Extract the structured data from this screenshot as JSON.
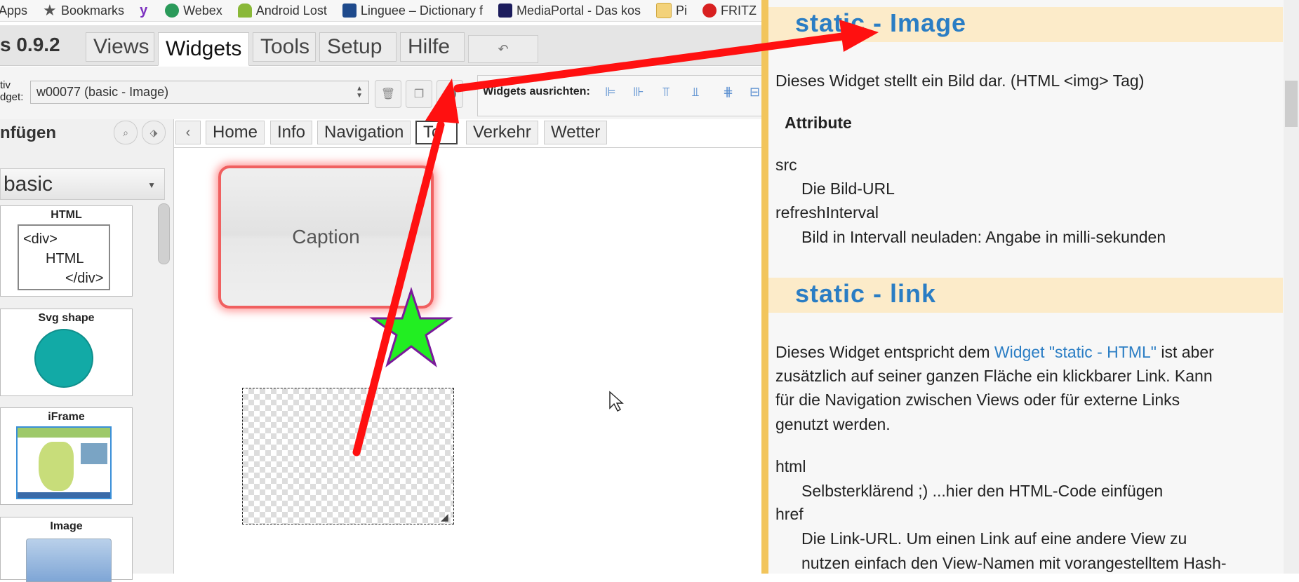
{
  "bookmarks": [
    {
      "label": "Apps",
      "icon": "apps-icon",
      "color": "#4a6ee0"
    },
    {
      "label": "Bookmarks",
      "icon": "star-icon",
      "color": "#555555"
    },
    {
      "label": "",
      "icon": "yahoo-icon",
      "color": "#7b2fbf"
    },
    {
      "label": "Webex",
      "icon": "webex-icon",
      "color": "#2a9a5a"
    },
    {
      "label": "Android Lost",
      "icon": "android-icon",
      "color": "#8ab838"
    },
    {
      "label": "Linguee – Dictionary f",
      "icon": "linguee-icon",
      "color": "#1e4a8c"
    },
    {
      "label": "MediaPortal - Das kos",
      "icon": "mediaportal-icon",
      "color": "#1c1c5c"
    },
    {
      "label": "Pi",
      "icon": "folder-icon",
      "color": "#e8c35a"
    },
    {
      "label": "FRITZ",
      "icon": "fritz-icon",
      "color": "#d82020"
    }
  ],
  "app": {
    "title": "s 0.9.2",
    "tabs": [
      "Views",
      "Widgets",
      "Tools",
      "Setup",
      "Hilfe"
    ],
    "active_tab": "Widgets",
    "undo_glyph": "↶"
  },
  "toolbar": {
    "aktiv_label_1": "tiv",
    "aktiv_label_2": "dget:",
    "selected_widget": "w00077 (basic - Image)",
    "align_label": "Widgets ausrichten:"
  },
  "palette": {
    "title": "nfügen",
    "category": "basic",
    "widgets": [
      {
        "title": "HTML",
        "preview_lines": [
          "<div>",
          "HTML",
          "</div>"
        ]
      },
      {
        "title": "Svg shape"
      },
      {
        "title": "iFrame"
      },
      {
        "title": "Image"
      }
    ]
  },
  "views": {
    "prev_glyph": "‹",
    "tabs": [
      "Home",
      "Info",
      "Navigation",
      "To",
      "Verkehr",
      "Wetter"
    ]
  },
  "canvas": {
    "caption_text": "Caption",
    "star_fill": "#22ee22",
    "star_stroke": "#7a1a9a",
    "arrow_color": "#ff1010"
  },
  "help": {
    "section1": {
      "title": "static - Image",
      "intro": "Dieses Widget stellt ein Bild dar. (HTML <img> Tag)",
      "attr_heading": "Attribute",
      "attrs": [
        {
          "name": "src",
          "desc": "Die Bild-URL"
        },
        {
          "name": "refreshInterval",
          "desc": "Bild in Intervall neuladen: Angabe in milli-sekunden"
        }
      ]
    },
    "section2": {
      "title": "static - link",
      "intro_before": "Dieses Widget entspricht dem",
      "intro_link": "Widget \"static - HTML\"",
      "intro_after": "ist aber",
      "intro_lines": [
        "zusätzlich auf seiner ganzen Fläche ein klickbarer Link. Kann",
        "für die Navigation zwischen Views oder für externe Links",
        "genutzt werden."
      ],
      "attrs": [
        {
          "name": "html",
          "desc": "Selbsterklärend ;) ...hier den HTML-Code einfügen"
        },
        {
          "name": "href",
          "desc": "Die Link-URL. Um einen Link auf eine andere View zu"
        }
      ],
      "trailing": "nutzen einfach den View-Namen mit vorangestelltem Hash-"
    }
  }
}
